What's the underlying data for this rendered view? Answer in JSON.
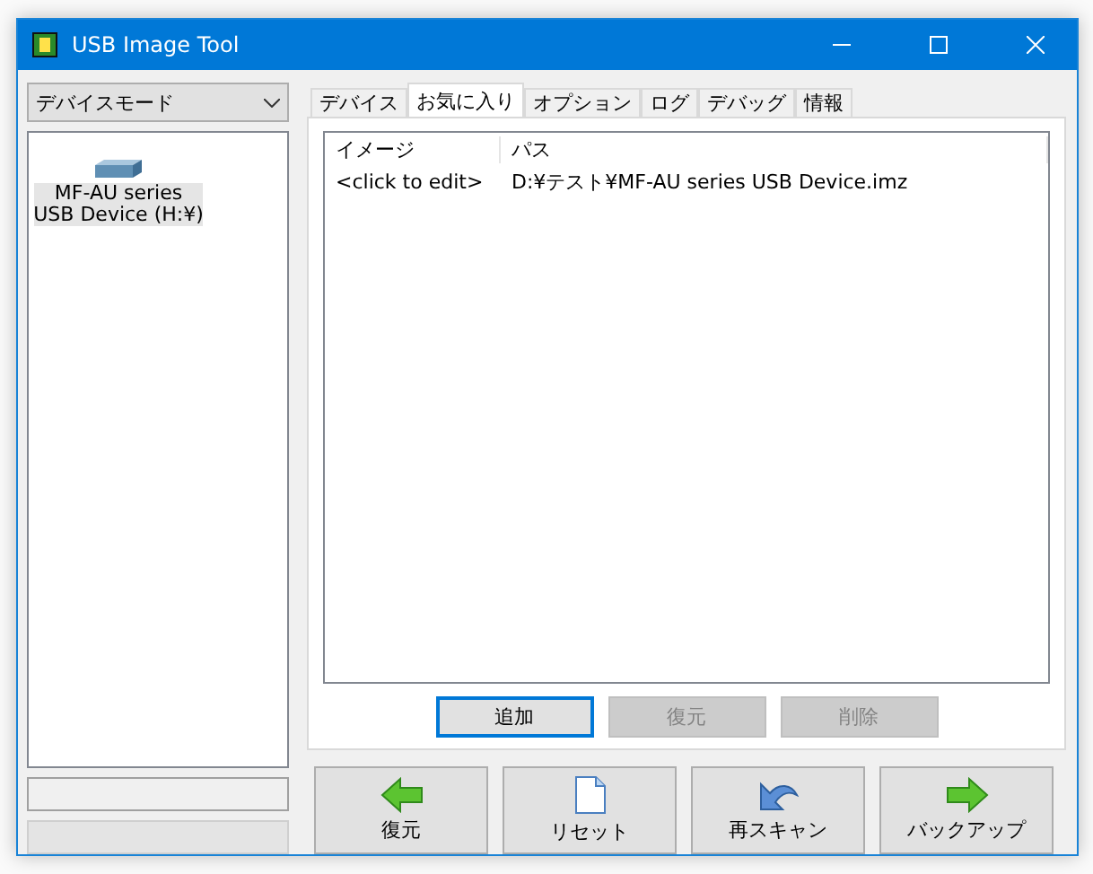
{
  "window": {
    "title": "USB Image Tool"
  },
  "mode_select": {
    "value": "デバイスモード"
  },
  "devices": [
    {
      "label": "MF-AU series\nUSB Device (H:¥)",
      "selected": true
    }
  ],
  "status_bars": [
    {
      "disabled": false
    },
    {
      "disabled": true
    }
  ],
  "tabs": [
    {
      "label": "デバイス",
      "selected": false
    },
    {
      "label": "お気に入り",
      "selected": true
    },
    {
      "label": "オプション",
      "selected": false
    },
    {
      "label": "ログ",
      "selected": false
    },
    {
      "label": "デバッグ",
      "selected": false
    },
    {
      "label": "情報",
      "selected": false
    }
  ],
  "table": {
    "columns": [
      "イメージ",
      "パス"
    ],
    "rows": [
      [
        "<click to edit>",
        "D:¥テスト¥MF-AU series USB Device.imz"
      ]
    ]
  },
  "list_buttons": [
    {
      "label": "追加",
      "disabled": false,
      "focused": true
    },
    {
      "label": "復元",
      "disabled": true,
      "focused": false
    },
    {
      "label": "削除",
      "disabled": true,
      "focused": false
    }
  ],
  "actions": [
    {
      "label": "復元",
      "kind": "left"
    },
    {
      "label": "リセット",
      "kind": "page"
    },
    {
      "label": "再スキャン",
      "kind": "rescan"
    },
    {
      "label": "バックアップ",
      "kind": "right"
    }
  ]
}
